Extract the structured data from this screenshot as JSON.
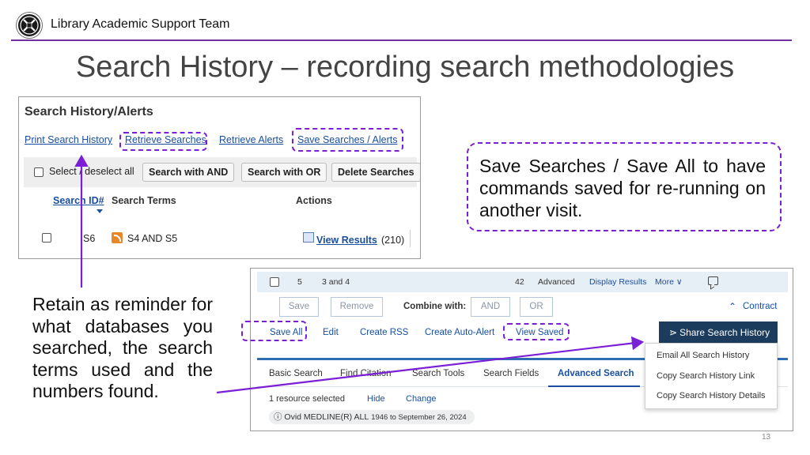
{
  "header": {
    "team": "Library Academic Support Team",
    "title": "Search History – recording search methodologies",
    "accent_color": "#7030a0"
  },
  "shot1": {
    "heading": "Search History/Alerts",
    "links": [
      "Print Search History",
      "Retrieve Searches",
      "Retrieve Alerts",
      "Save Searches / Alerts"
    ],
    "select_label": "Select / deselect all",
    "buttons": [
      "Search with AND",
      "Search with OR",
      "Delete Searches"
    ],
    "columns": {
      "search_id": "Search ID#",
      "search_terms": "Search Terms",
      "actions": "Actions"
    },
    "row": {
      "id": "S6",
      "terms": "S4 AND S5",
      "view": "View Results",
      "count": "(210)"
    }
  },
  "callout": {
    "text": "Save Searches / Save All to have commands saved for re-running on another visit.",
    "border_color": "#7a1fd6"
  },
  "retain_text": "Retain as reminder for what databases you searched, the search terms used and the numbers found.",
  "shot2": {
    "row": {
      "num": "5",
      "query": "3 and 4",
      "count": "42",
      "type": "Advanced",
      "display": "Display Results",
      "more": "More ∨"
    },
    "buttons": {
      "save": "Save",
      "remove": "Remove",
      "and": "AND",
      "or": "OR"
    },
    "combine_label": "Combine with:",
    "contract": "Contract",
    "links": {
      "save_all": "Save All",
      "edit": "Edit",
      "create_rss": "Create RSS",
      "create_auto_alert": "Create Auto-Alert",
      "view_saved": "View Saved"
    },
    "share_button": "Share Search History",
    "dropdown": [
      "Email All Search History",
      "Copy Search History Link",
      "Copy Search History Details"
    ],
    "tabs": [
      "Basic Search",
      "Find Citation",
      "Search Tools",
      "Search Fields",
      "Advanced Search"
    ],
    "active_tab": "Advanced Search",
    "resource_selected": "1 resource selected",
    "hide": "Hide",
    "change": "Change",
    "database": "Ovid MEDLINE(R) ALL",
    "database_range": "1946 to September 26, 2024"
  },
  "page_number": "13",
  "icons": {
    "logo": "university-crest-icon",
    "rss": "rss-icon",
    "view": "search-icon",
    "chat": "chat-icon",
    "contract": "chevron-up-double-icon",
    "share": "share-icon",
    "info": "info-icon"
  }
}
